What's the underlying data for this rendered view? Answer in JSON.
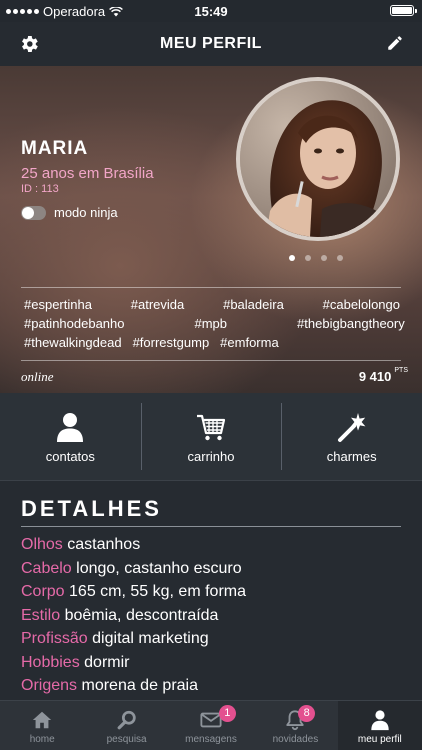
{
  "status_bar": {
    "carrier": "Operadora",
    "time": "15:49",
    "battery_level": 1.0
  },
  "nav": {
    "title": "MEU PERFIL"
  },
  "profile": {
    "name": "MARIA",
    "age_location": "25 anos em Brasília",
    "id_text": "ID : 113",
    "ninja_label": "modo ninja",
    "ninja_enabled": false,
    "photo_pages": 4,
    "active_photo_page": 1,
    "tags": [
      [
        "#espertinha",
        "#atrevida",
        "#baladeira",
        "#cabelolongo"
      ],
      [
        "#patinhodebanho",
        "#mpb",
        "#thebigbangtheory"
      ],
      [
        "#thewalkingdead",
        "#forrestgump",
        "#emforma"
      ]
    ],
    "status": "online",
    "points": "9 410",
    "points_unit": "PTS"
  },
  "actions": [
    {
      "label": "contatos",
      "icon": "person-icon"
    },
    {
      "label": "carrinho",
      "icon": "cart-icon"
    },
    {
      "label": "charmes",
      "icon": "magic-wand-icon"
    }
  ],
  "details": {
    "title": "DETALHES",
    "items": [
      {
        "key": "Olhos",
        "value": "castanhos"
      },
      {
        "key": "Cabelo",
        "value": "longo, castanho escuro"
      },
      {
        "key": "Corpo",
        "value": "165 cm, 55 kg, em forma"
      },
      {
        "key": "Estilo",
        "value": "boêmia, descontraída"
      },
      {
        "key": "Profissão",
        "value": "digital marketing"
      },
      {
        "key": "Hobbies",
        "value": "dormir"
      },
      {
        "key": "Origens",
        "value": "morena de praia"
      }
    ]
  },
  "tabs": [
    {
      "label": "home",
      "icon": "home-icon",
      "badge": ""
    },
    {
      "label": "pesquisa",
      "icon": "search-icon",
      "badge": ""
    },
    {
      "label": "mensagens",
      "icon": "envelope-icon",
      "badge": "1"
    },
    {
      "label": "novidades",
      "icon": "bell-icon",
      "badge": "8"
    },
    {
      "label": "meu perfil",
      "icon": "profile-icon",
      "badge": ""
    }
  ],
  "active_tab": "meu perfil",
  "colors": {
    "accent_pink": "#e56aa8",
    "badge": "#e3508f",
    "background": "#262b31"
  }
}
